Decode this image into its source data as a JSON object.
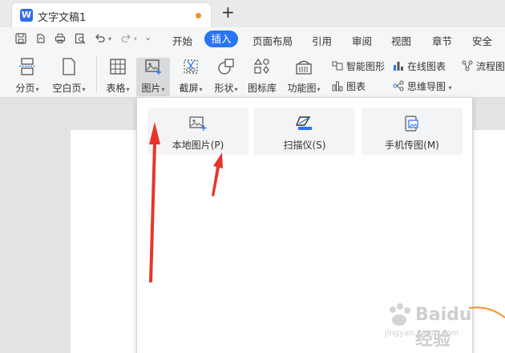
{
  "tab": {
    "doc_title": "文字文稿1",
    "app_letter": "W",
    "new_tab": "+"
  },
  "menu": {
    "items": [
      "开始",
      "插入",
      "页面布局",
      "引用",
      "审阅",
      "视图",
      "章节",
      "安全"
    ],
    "active": "插入"
  },
  "ribbon": {
    "page_break": "分页",
    "blank_page": "空白页",
    "table": "表格",
    "picture": "图片",
    "screenshot": "截屏",
    "shapes": "形状",
    "icon_library": "图标库",
    "function_chart": "功能图",
    "smart_graphic": "智能图形",
    "online_chart": "在线图表",
    "flowchart": "流程图",
    "chart": "图表",
    "mind_map": "思维导图"
  },
  "dropdown": {
    "local_picture": "本地图片(P)",
    "scanner": "扫描仪(S)",
    "phone_picture": "手机传图(M)"
  },
  "watermark": {
    "text": "Baidu经验",
    "sub": "jingyan.baidu.com"
  },
  "colors": {
    "accent": "#2b74f2",
    "arrow": "#e8352b",
    "curve": "#f0932b"
  }
}
